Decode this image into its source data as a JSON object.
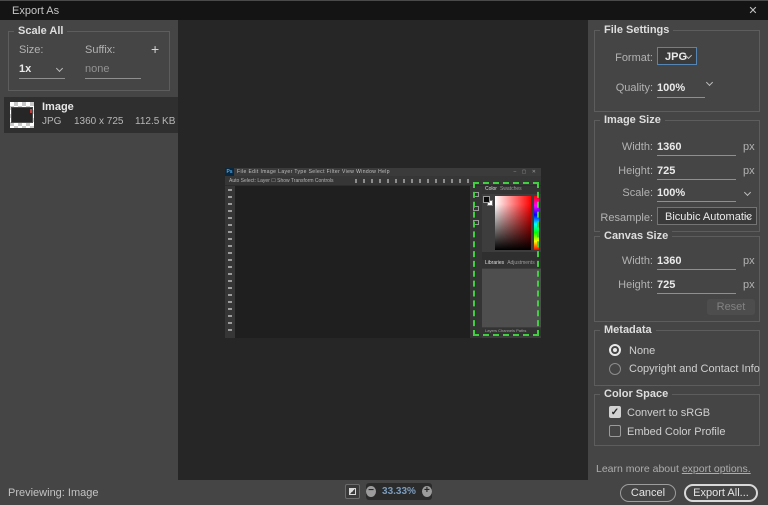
{
  "window": {
    "title": "Export As"
  },
  "icons": {
    "close": "✕",
    "plus": "+",
    "minus": "−",
    "check": "✓"
  },
  "left_panel": {
    "scale_all": {
      "heading": "Scale All",
      "size_label": "Size:",
      "size_value": "1x",
      "suffix_label": "Suffix:",
      "suffix_placeholder": "none"
    },
    "image_item": {
      "name": "Image",
      "format": "JPG",
      "dimensions": "1360 x 725",
      "file_size": "112.5 KB"
    }
  },
  "preview": {
    "logo": "Ps",
    "menus": "File  Edit  Image  Layer  Type  Select  Filter  View  Window  Help",
    "window_controls": "– ▢ ✕",
    "options_text": "Auto Select:  Layer   ☐ Show Transform Controls",
    "color_tab": "Color",
    "swatches_tab": "Swatches",
    "libraries_tab": "Libraries",
    "adjustments_tab": "Adjustments",
    "bottom_tabs": "Layers   Channels   Paths"
  },
  "right_panel": {
    "file_settings": {
      "heading": "File Settings",
      "format_label": "Format:",
      "format_value": "JPG",
      "quality_label": "Quality:",
      "quality_value": "100%"
    },
    "image_size": {
      "heading": "Image Size",
      "width_label": "Width:",
      "width_value": "1360",
      "height_label": "Height:",
      "height_value": "725",
      "unit": "px",
      "scale_label": "Scale:",
      "scale_value": "100%",
      "resample_label": "Resample:",
      "resample_value": "Bicubic Automatic"
    },
    "canvas_size": {
      "heading": "Canvas Size",
      "width_label": "Width:",
      "width_value": "1360",
      "height_label": "Height:",
      "height_value": "725",
      "unit": "px",
      "reset_label": "Reset"
    },
    "metadata": {
      "heading": "Metadata",
      "options": [
        {
          "label": "None",
          "selected": true
        },
        {
          "label": "Copyright and Contact Info",
          "selected": false
        }
      ]
    },
    "color_space": {
      "heading": "Color Space",
      "options": [
        {
          "label": "Convert to sRGB",
          "checked": true
        },
        {
          "label": "Embed Color Profile",
          "checked": false
        }
      ]
    },
    "learn_more": {
      "prefix": "Learn more about ",
      "link": "export options."
    }
  },
  "footer": {
    "previewing": "Previewing: Image",
    "zoom_value": "33.33%",
    "cancel_label": "Cancel",
    "export_label": "Export All..."
  },
  "colors": {
    "accent_blue": "#5585b5",
    "selection_green": "#3fcf3f",
    "zoom_text_blue": "#7c9cbd"
  }
}
